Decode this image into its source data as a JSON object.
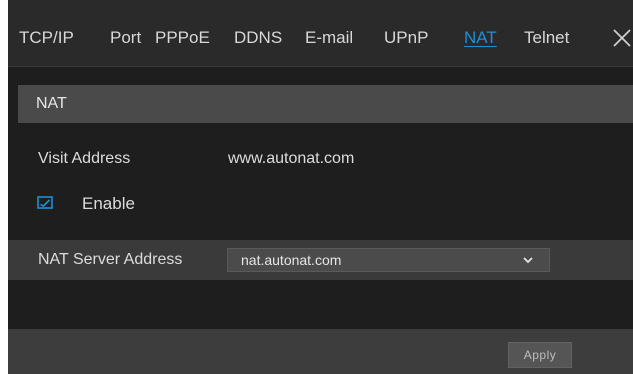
{
  "tabs": [
    {
      "label": "TCP/IP",
      "active": false
    },
    {
      "label": "Port",
      "active": false
    },
    {
      "label": "PPPoE",
      "active": false
    },
    {
      "label": "DDNS",
      "active": false
    },
    {
      "label": "E-mail",
      "active": false
    },
    {
      "label": "UPnP",
      "active": false
    },
    {
      "label": "NAT",
      "active": true
    },
    {
      "label": "Telnet",
      "active": false
    }
  ],
  "close_icon": "close-icon",
  "section": {
    "title": "NAT"
  },
  "visit_address": {
    "label": "Visit Address",
    "value": "www.autonat.com"
  },
  "enable": {
    "label": "Enable",
    "checked": true
  },
  "nat_server": {
    "label": "NAT Server Address",
    "selected": "nat.autonat.com"
  },
  "footer": {
    "apply_label": "Apply"
  },
  "colors": {
    "active_tab": "#1e8fd8",
    "checkbox": "#1e8fd8"
  }
}
